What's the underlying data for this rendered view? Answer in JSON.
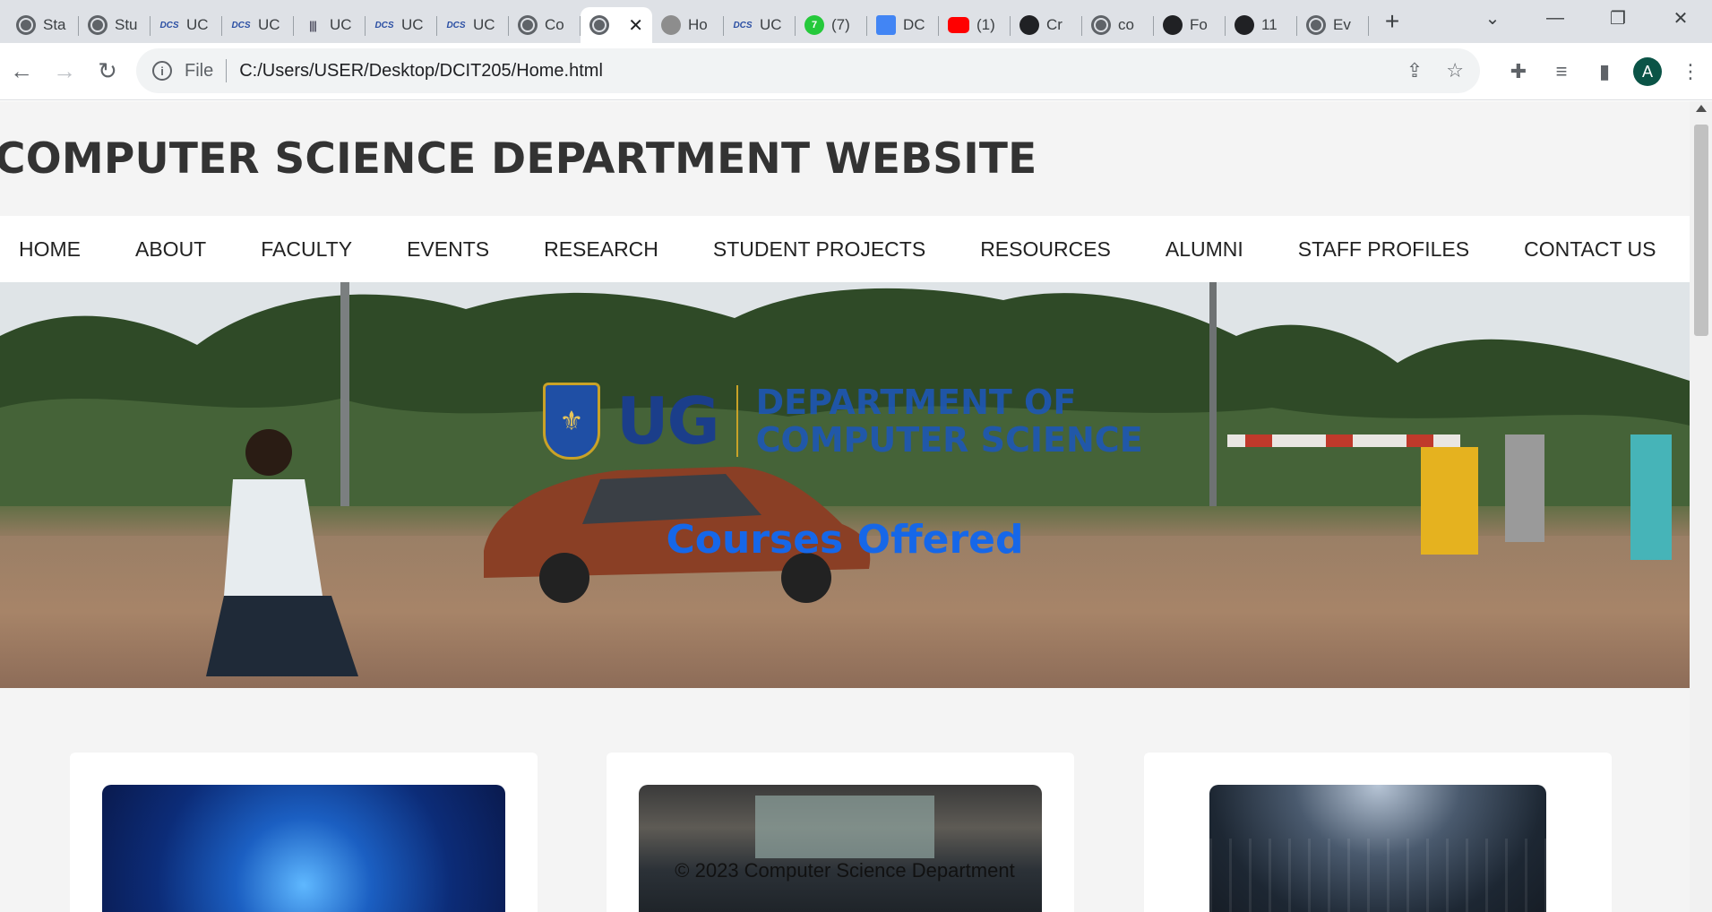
{
  "browser": {
    "tabs": [
      {
        "title": "Sta",
        "icon": "globe-icon"
      },
      {
        "title": "Stu",
        "icon": "globe-icon"
      },
      {
        "title": "UC",
        "icon": "dcs-icon"
      },
      {
        "title": "UC",
        "icon": "dcs-icon"
      },
      {
        "title": "UC",
        "icon": "bars-icon"
      },
      {
        "title": "UC",
        "icon": "dcs-icon"
      },
      {
        "title": "UC",
        "icon": "dcs-icon"
      },
      {
        "title": "Co",
        "icon": "globe-icon"
      },
      {
        "title": "",
        "icon": "globe-icon",
        "active": true
      },
      {
        "title": "Ho",
        "icon": "ug-icon"
      },
      {
        "title": "UC",
        "icon": "dcs-icon"
      },
      {
        "title": "(7)",
        "icon": "seven-icon"
      },
      {
        "title": "DC",
        "icon": "docs-icon"
      },
      {
        "title": "(1)",
        "icon": "youtube-icon"
      },
      {
        "title": "Cr",
        "icon": "github-icon"
      },
      {
        "title": "co",
        "icon": "globe-icon"
      },
      {
        "title": "Fo",
        "icon": "github-icon"
      },
      {
        "title": "11",
        "icon": "github-icon"
      },
      {
        "title": "Ev",
        "icon": "globe-icon"
      }
    ],
    "address": {
      "scheme_label": "File",
      "url": "C:/Users/USER/Desktop/DCIT205/Home.html"
    },
    "profile_initial": "A"
  },
  "site": {
    "title": "COMPUTER SCIENCE DEPARTMENT WEBSITE",
    "nav": [
      "HOME",
      "ABOUT",
      "FACULTY",
      "EVENTS",
      "RESEARCH",
      "STUDENT PROJECTS",
      "RESOURCES",
      "ALUMNI",
      "STAFF PROFILES",
      "CONTACT US"
    ],
    "hero": {
      "logo_letters": "UG",
      "logo_line1": "DEPARTMENT OF",
      "logo_line2": "COMPUTER SCIENCE",
      "heading": "Courses Offered"
    },
    "footer": "© 2023 Computer Science Department"
  }
}
